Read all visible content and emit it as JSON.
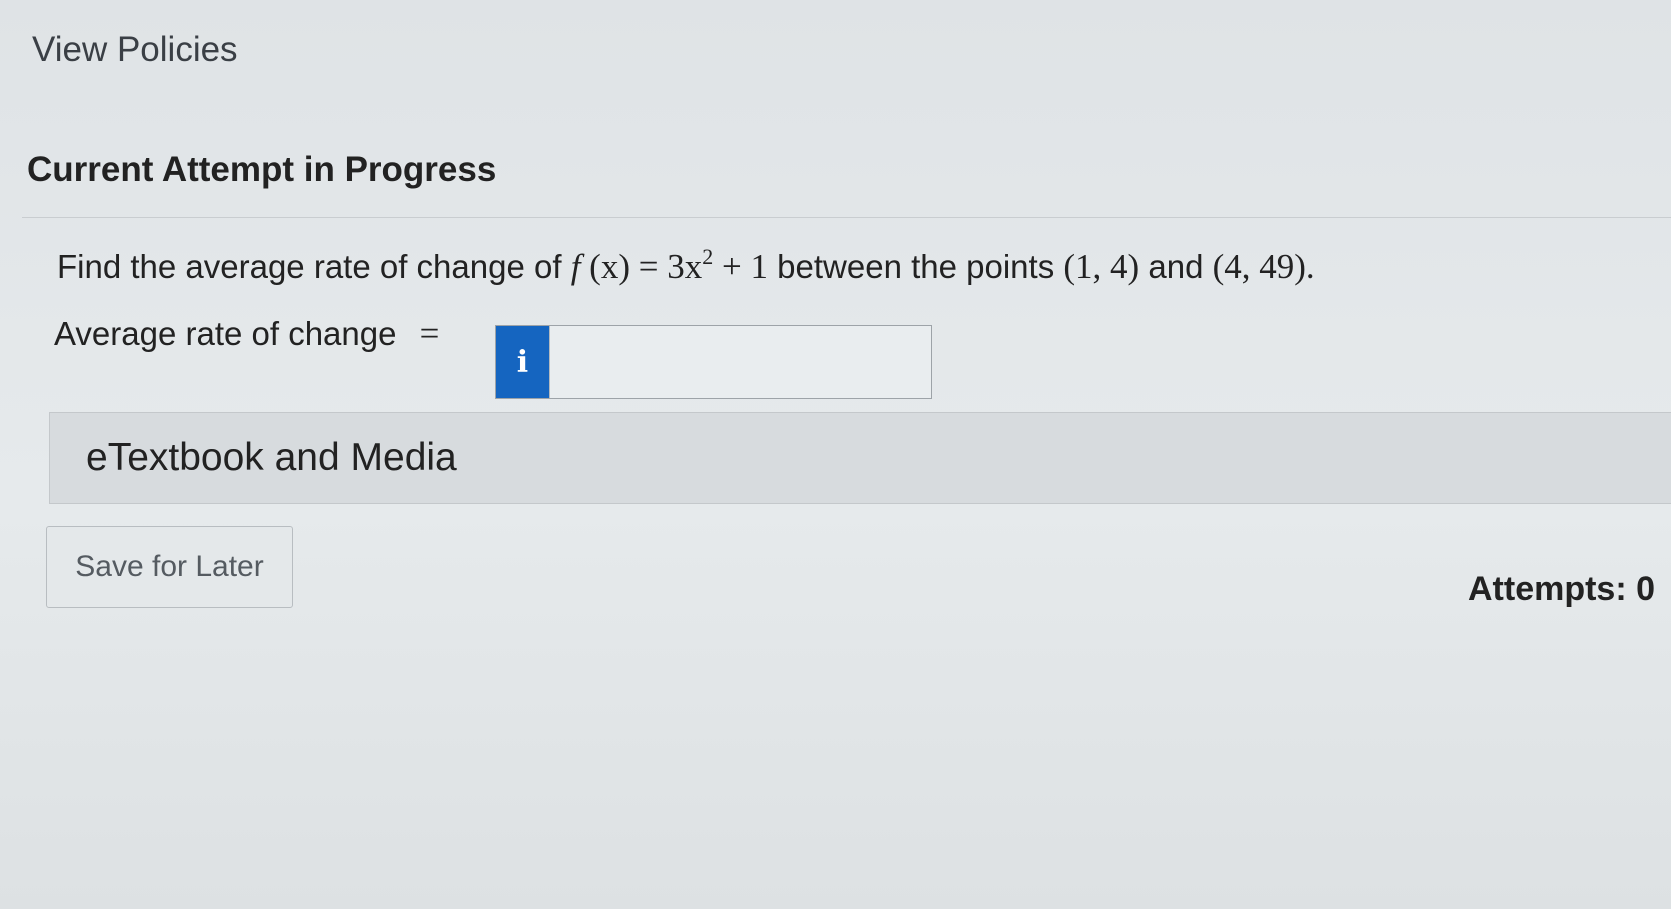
{
  "header": {
    "view_policies": "View Policies",
    "attempt_heading": "Current Attempt in Progress"
  },
  "question": {
    "text_before": "Find the average rate of change of",
    "function_name": "f",
    "function_var": "(x)",
    "equals": " = ",
    "expr_base": "3x",
    "expr_exponent": "2",
    "expr_tail": " + 1",
    "text_between": "between the points",
    "point_a": "(1, 4)",
    "conjunction": "and",
    "point_b": "(4, 49).",
    "answer_label": "Average rate of change",
    "answer_equals": "=",
    "info_icon_glyph": "i",
    "answer_value": ""
  },
  "etextbook": {
    "label": "eTextbook and Media"
  },
  "footer": {
    "save_label": "Save for Later",
    "attempts_label": "Attempts: 0"
  },
  "colors": {
    "info_button": "#1565c0"
  }
}
